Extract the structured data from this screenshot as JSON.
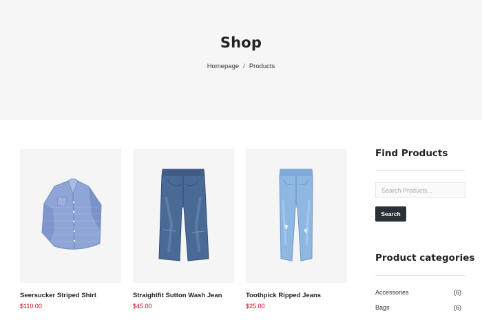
{
  "hero": {
    "title": "Shop",
    "breadcrumb": {
      "home": "Homepage",
      "separator": "/",
      "current": "Products"
    }
  },
  "products": [
    {
      "name": "Seersucker Striped Shirt",
      "price": "$110.00",
      "image_icon": "shirt-icon"
    },
    {
      "name": "Straightfit Sutton Wash Jean",
      "price": "$45.00",
      "image_icon": "jeans-icon"
    },
    {
      "name": "Toothpick Ripped Jeans",
      "price": "$25.00",
      "image_icon": "jeans-icon"
    }
  ],
  "sidebar": {
    "find_products": {
      "title": "Find Products",
      "search_placeholder": "Search Products...",
      "search_button": "Search"
    },
    "categories": {
      "title": "Product categories",
      "items": [
        {
          "label": "Accessories",
          "count": "(6)"
        },
        {
          "label": "Bags",
          "count": "(6)"
        }
      ]
    }
  },
  "colors": {
    "hero_background": "#f6f6f6",
    "price": "#d0021b",
    "button_background": "#2b2f36",
    "image_background": "#f5f5f5"
  }
}
